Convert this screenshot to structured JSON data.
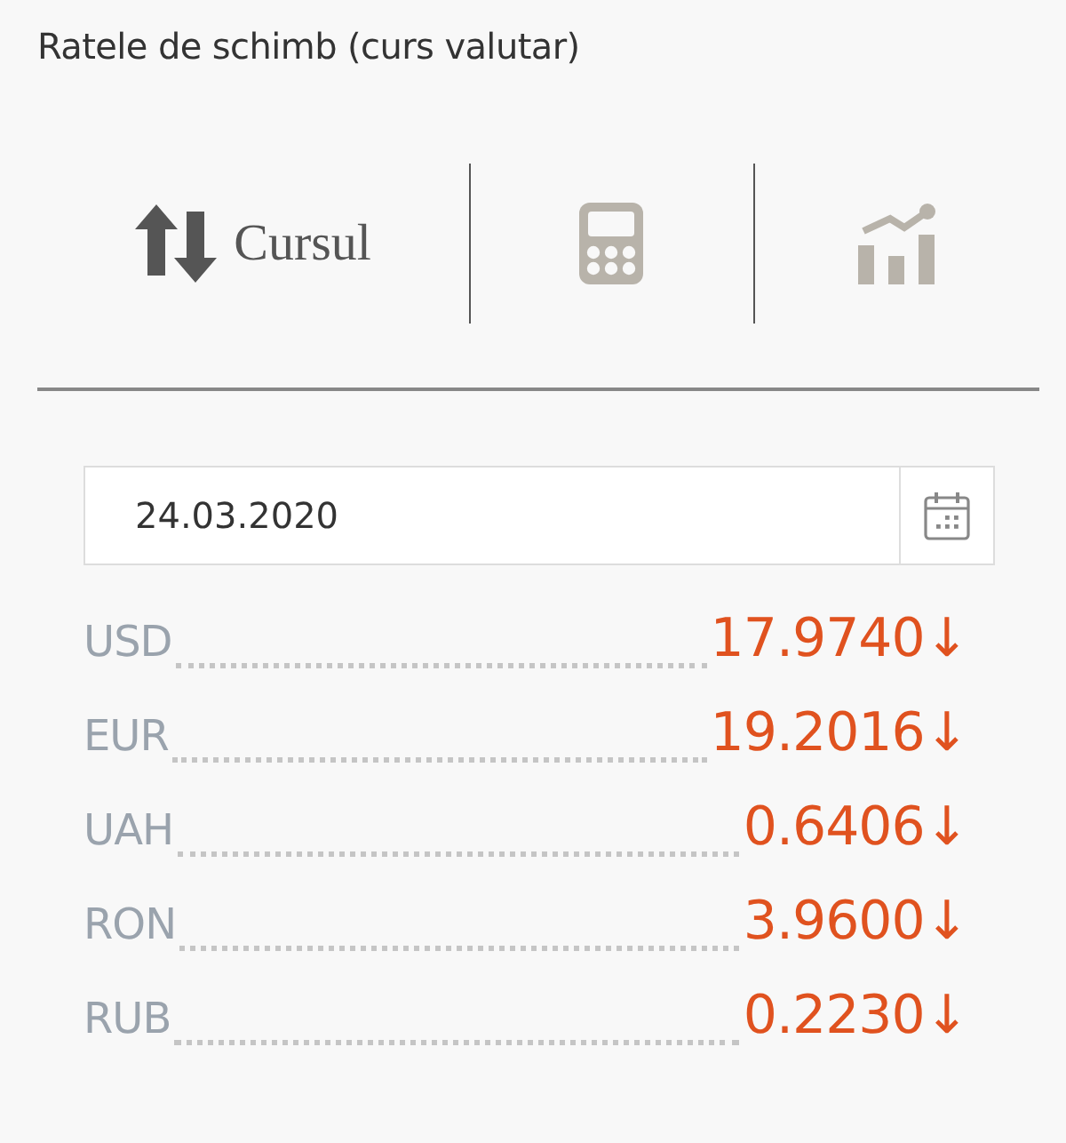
{
  "title": "Ratele de schimb (curs valutar)",
  "tabs": [
    {
      "kind": "exchange",
      "label": "Cursul",
      "selected": true
    },
    {
      "kind": "calculator",
      "selected": false
    },
    {
      "kind": "chart",
      "selected": false
    }
  ],
  "date_field": {
    "value": "24.03.2020"
  },
  "rates": [
    {
      "currency": "USD",
      "value": "17.9740",
      "arrow": "↓"
    },
    {
      "currency": "EUR",
      "value": "19.2016",
      "arrow": "↓"
    },
    {
      "currency": "UAH",
      "value": "0.6406",
      "arrow": "↓"
    },
    {
      "currency": "RON",
      "value": "3.9600",
      "arrow": "↓"
    },
    {
      "currency": "RUB",
      "value": "0.2230",
      "arrow": "↓"
    }
  ]
}
